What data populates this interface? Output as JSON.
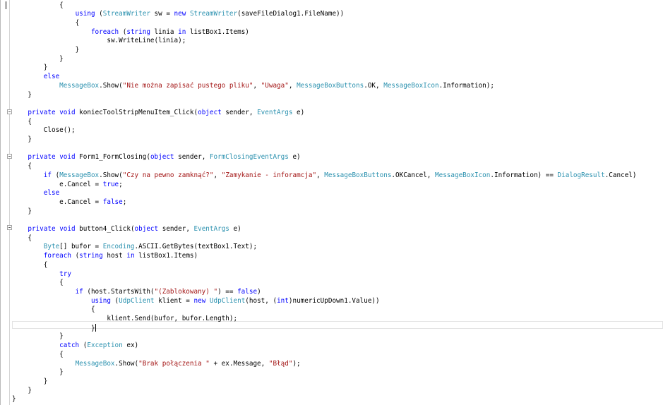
{
  "editor": {
    "lines": [
      {
        "indent": "            ",
        "tokens": [
          {
            "t": "{",
            "c": ""
          }
        ]
      },
      {
        "indent": "                ",
        "tokens": [
          {
            "t": "using",
            "c": "kw"
          },
          {
            "t": " (",
            "c": ""
          },
          {
            "t": "StreamWriter",
            "c": "ty"
          },
          {
            "t": " sw = ",
            "c": ""
          },
          {
            "t": "new",
            "c": "kw"
          },
          {
            "t": " ",
            "c": ""
          },
          {
            "t": "StreamWriter",
            "c": "ty"
          },
          {
            "t": "(saveFileDialog1.FileName))",
            "c": ""
          }
        ]
      },
      {
        "indent": "                ",
        "tokens": [
          {
            "t": "{",
            "c": ""
          }
        ]
      },
      {
        "indent": "                    ",
        "tokens": [
          {
            "t": "foreach",
            "c": "kw"
          },
          {
            "t": " (",
            "c": ""
          },
          {
            "t": "string",
            "c": "kw"
          },
          {
            "t": " linia ",
            "c": ""
          },
          {
            "t": "in",
            "c": "kw"
          },
          {
            "t": " listBox1.Items)",
            "c": ""
          }
        ]
      },
      {
        "indent": "                        ",
        "tokens": [
          {
            "t": "sw.WriteLine(linia);",
            "c": ""
          }
        ]
      },
      {
        "indent": "                ",
        "tokens": [
          {
            "t": "}",
            "c": ""
          }
        ]
      },
      {
        "indent": "            ",
        "tokens": [
          {
            "t": "}",
            "c": ""
          }
        ]
      },
      {
        "indent": "        ",
        "tokens": [
          {
            "t": "}",
            "c": ""
          }
        ]
      },
      {
        "indent": "        ",
        "tokens": [
          {
            "t": "else",
            "c": "kw"
          }
        ]
      },
      {
        "indent": "            ",
        "tokens": [
          {
            "t": "MessageBox",
            "c": "ty"
          },
          {
            "t": ".Show(",
            "c": ""
          },
          {
            "t": "\"Nie można zapisać pustego pliku\"",
            "c": "st"
          },
          {
            "t": ", ",
            "c": ""
          },
          {
            "t": "\"Uwaga\"",
            "c": "st"
          },
          {
            "t": ", ",
            "c": ""
          },
          {
            "t": "MessageBoxButtons",
            "c": "ty"
          },
          {
            "t": ".OK, ",
            "c": ""
          },
          {
            "t": "MessageBoxIcon",
            "c": "ty"
          },
          {
            "t": ".Information);",
            "c": ""
          }
        ]
      },
      {
        "indent": "    ",
        "tokens": [
          {
            "t": "}",
            "c": ""
          }
        ]
      },
      {
        "indent": "",
        "tokens": []
      },
      {
        "indent": "    ",
        "tokens": [
          {
            "t": "private",
            "c": "kw"
          },
          {
            "t": " ",
            "c": ""
          },
          {
            "t": "void",
            "c": "kw"
          },
          {
            "t": " koniecToolStripMenuItem_Click(",
            "c": ""
          },
          {
            "t": "object",
            "c": "kw"
          },
          {
            "t": " sender, ",
            "c": ""
          },
          {
            "t": "EventArgs",
            "c": "ty"
          },
          {
            "t": " e)",
            "c": ""
          }
        ]
      },
      {
        "indent": "    ",
        "tokens": [
          {
            "t": "{",
            "c": ""
          }
        ]
      },
      {
        "indent": "        ",
        "tokens": [
          {
            "t": "Close();",
            "c": ""
          }
        ]
      },
      {
        "indent": "    ",
        "tokens": [
          {
            "t": "}",
            "c": ""
          }
        ]
      },
      {
        "indent": "",
        "tokens": []
      },
      {
        "indent": "    ",
        "tokens": [
          {
            "t": "private",
            "c": "kw"
          },
          {
            "t": " ",
            "c": ""
          },
          {
            "t": "void",
            "c": "kw"
          },
          {
            "t": " Form1_FormClosing(",
            "c": ""
          },
          {
            "t": "object",
            "c": "kw"
          },
          {
            "t": " sender, ",
            "c": ""
          },
          {
            "t": "FormClosingEventArgs",
            "c": "ty"
          },
          {
            "t": " e)",
            "c": ""
          }
        ]
      },
      {
        "indent": "    ",
        "tokens": [
          {
            "t": "{",
            "c": ""
          }
        ]
      },
      {
        "indent": "        ",
        "tokens": [
          {
            "t": "if",
            "c": "kw"
          },
          {
            "t": " (",
            "c": ""
          },
          {
            "t": "MessageBox",
            "c": "ty"
          },
          {
            "t": ".Show(",
            "c": ""
          },
          {
            "t": "\"Czy na pewno zamknąć?\"",
            "c": "st"
          },
          {
            "t": ", ",
            "c": ""
          },
          {
            "t": "\"Zamykanie - inforamcja\"",
            "c": "st"
          },
          {
            "t": ", ",
            "c": ""
          },
          {
            "t": "MessageBoxButtons",
            "c": "ty"
          },
          {
            "t": ".OKCancel, ",
            "c": ""
          },
          {
            "t": "MessageBoxIcon",
            "c": "ty"
          },
          {
            "t": ".Information) == ",
            "c": ""
          },
          {
            "t": "DialogResult",
            "c": "ty"
          },
          {
            "t": ".Cancel)",
            "c": ""
          }
        ]
      },
      {
        "indent": "            ",
        "tokens": [
          {
            "t": "e.Cancel = ",
            "c": ""
          },
          {
            "t": "true",
            "c": "kw"
          },
          {
            "t": ";",
            "c": ""
          }
        ]
      },
      {
        "indent": "        ",
        "tokens": [
          {
            "t": "else",
            "c": "kw"
          }
        ]
      },
      {
        "indent": "            ",
        "tokens": [
          {
            "t": "e.Cancel = ",
            "c": ""
          },
          {
            "t": "false",
            "c": "kw"
          },
          {
            "t": ";",
            "c": ""
          }
        ]
      },
      {
        "indent": "    ",
        "tokens": [
          {
            "t": "}",
            "c": ""
          }
        ]
      },
      {
        "indent": "",
        "tokens": []
      },
      {
        "indent": "    ",
        "tokens": [
          {
            "t": "private",
            "c": "kw"
          },
          {
            "t": " ",
            "c": ""
          },
          {
            "t": "void",
            "c": "kw"
          },
          {
            "t": " button4_Click(",
            "c": ""
          },
          {
            "t": "object",
            "c": "kw"
          },
          {
            "t": " sender, ",
            "c": ""
          },
          {
            "t": "EventArgs",
            "c": "ty"
          },
          {
            "t": " e)",
            "c": ""
          }
        ]
      },
      {
        "indent": "    ",
        "tokens": [
          {
            "t": "{",
            "c": ""
          }
        ]
      },
      {
        "indent": "        ",
        "tokens": [
          {
            "t": "Byte",
            "c": "ty"
          },
          {
            "t": "[] bufor = ",
            "c": ""
          },
          {
            "t": "Encoding",
            "c": "ty"
          },
          {
            "t": ".ASCII.GetBytes(textBox1.Text);",
            "c": ""
          }
        ]
      },
      {
        "indent": "        ",
        "tokens": [
          {
            "t": "foreach",
            "c": "kw"
          },
          {
            "t": " (",
            "c": ""
          },
          {
            "t": "string",
            "c": "kw"
          },
          {
            "t": " host ",
            "c": ""
          },
          {
            "t": "in",
            "c": "kw"
          },
          {
            "t": " listBox1.Items)",
            "c": ""
          }
        ]
      },
      {
        "indent": "        ",
        "tokens": [
          {
            "t": "{",
            "c": ""
          }
        ]
      },
      {
        "indent": "            ",
        "tokens": [
          {
            "t": "try",
            "c": "kw"
          }
        ]
      },
      {
        "indent": "            ",
        "tokens": [
          {
            "t": "{",
            "c": ""
          }
        ]
      },
      {
        "indent": "                ",
        "tokens": [
          {
            "t": "if",
            "c": "kw"
          },
          {
            "t": " (host.StartsWith(",
            "c": ""
          },
          {
            "t": "\"(Zablokowany) \"",
            "c": "st"
          },
          {
            "t": ") == ",
            "c": ""
          },
          {
            "t": "false",
            "c": "kw"
          },
          {
            "t": ")",
            "c": ""
          }
        ]
      },
      {
        "indent": "                    ",
        "tokens": [
          {
            "t": "using",
            "c": "kw"
          },
          {
            "t": " (",
            "c": ""
          },
          {
            "t": "UdpClient",
            "c": "ty"
          },
          {
            "t": " klient = ",
            "c": ""
          },
          {
            "t": "new",
            "c": "kw"
          },
          {
            "t": " ",
            "c": ""
          },
          {
            "t": "UdpClient",
            "c": "ty"
          },
          {
            "t": "(host, (",
            "c": ""
          },
          {
            "t": "int",
            "c": "kw"
          },
          {
            "t": ")numericUpDown1.Value))",
            "c": ""
          }
        ]
      },
      {
        "indent": "                    ",
        "tokens": [
          {
            "t": "{",
            "c": ""
          }
        ]
      },
      {
        "indent": "                        ",
        "tokens": [
          {
            "t": "klient.Send(bufor, bufor.Length);",
            "c": ""
          }
        ]
      },
      {
        "indent": "                    ",
        "tokens": [
          {
            "t": "}",
            "c": ""
          }
        ],
        "caret": true
      },
      {
        "indent": "            ",
        "tokens": [
          {
            "t": "}",
            "c": ""
          }
        ]
      },
      {
        "indent": "            ",
        "tokens": [
          {
            "t": "catch",
            "c": "kw"
          },
          {
            "t": " (",
            "c": ""
          },
          {
            "t": "Exception",
            "c": "ty"
          },
          {
            "t": " ex)",
            "c": ""
          }
        ]
      },
      {
        "indent": "            ",
        "tokens": [
          {
            "t": "{",
            "c": ""
          }
        ]
      },
      {
        "indent": "                ",
        "tokens": [
          {
            "t": "MessageBox",
            "c": "ty"
          },
          {
            "t": ".Show(",
            "c": ""
          },
          {
            "t": "\"Brak połączenia \"",
            "c": "st"
          },
          {
            "t": " + ex.Message, ",
            "c": ""
          },
          {
            "t": "\"Błąd\"",
            "c": "st"
          },
          {
            "t": ");",
            "c": ""
          }
        ]
      },
      {
        "indent": "            ",
        "tokens": [
          {
            "t": "}",
            "c": ""
          }
        ]
      },
      {
        "indent": "        ",
        "tokens": [
          {
            "t": "}",
            "c": ""
          }
        ]
      },
      {
        "indent": "    ",
        "tokens": [
          {
            "t": "}",
            "c": ""
          }
        ]
      },
      {
        "indent": "",
        "tokens": [
          {
            "t": "}",
            "c": ""
          }
        ]
      }
    ]
  }
}
